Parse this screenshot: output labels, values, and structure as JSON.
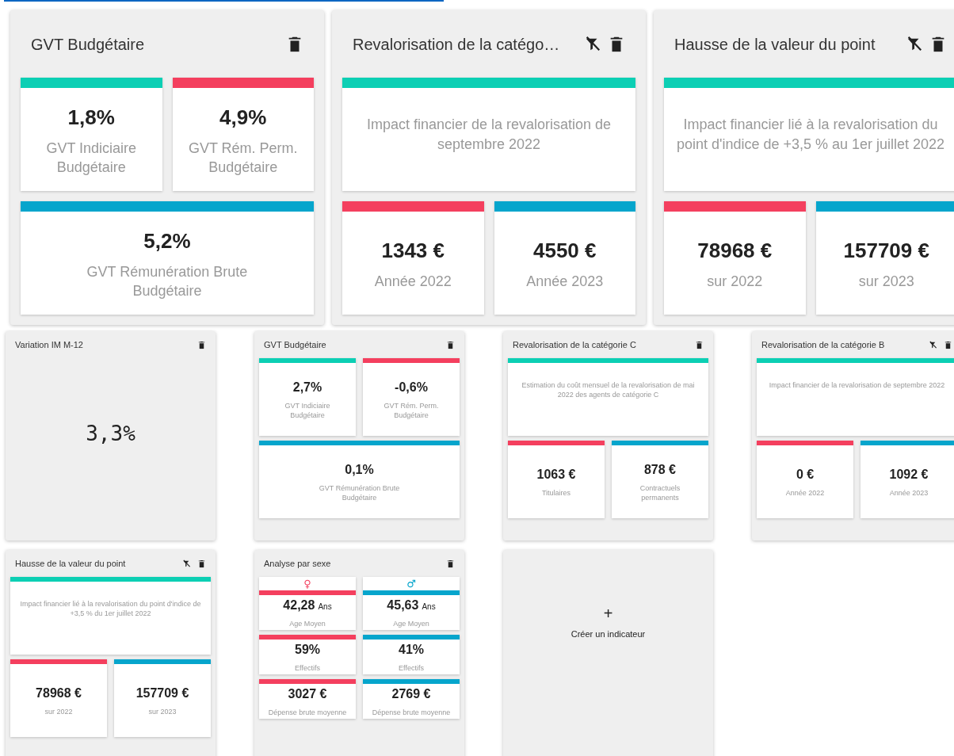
{
  "featured_widgets": [
    {
      "kind": "split",
      "title": "GVT Budgétaire",
      "filter_icon": false,
      "tiles": [
        {
          "value": "1,8%",
          "label": "GVT Indiciaire Budgétaire",
          "color": "#0ccfb4"
        },
        {
          "value": "4,9%",
          "label": "GVT Rém. Perm. Budgétaire",
          "color": "#f43f5e"
        },
        {
          "value": "5,2%",
          "label": "GVT Rémunération Brute Budgétaire",
          "color": "#06a5cc"
        }
      ]
    },
    {
      "kind": "description",
      "title": "Revalorisation de la catégo…",
      "filter_icon": true,
      "description": {
        "text": "Impact financier de la revalorisation de septembre 2022",
        "color": "#0ccfb4"
      },
      "tiles": [
        {
          "value": "1343 €",
          "label": "Année 2022",
          "color": "#f43f5e"
        },
        {
          "value": "4550 €",
          "label": "Année 2023",
          "color": "#06a5cc"
        }
      ]
    },
    {
      "kind": "description",
      "title": "Hausse de la valeur du point",
      "filter_icon": true,
      "description": {
        "text": "Impact financier lié à la revalorisation du point d'indice de +3,5 % au 1er juillet 2022",
        "color": "#0ccfb4"
      },
      "tiles": [
        {
          "value": "78968 €",
          "label": "sur 2022",
          "color": "#f43f5e"
        },
        {
          "value": "157709 €",
          "label": "sur 2023",
          "color": "#06a5cc"
        }
      ]
    }
  ],
  "widgets": [
    {
      "kind": "single",
      "title": "Variation IM M-12",
      "filter_icon": false,
      "value": "3,3%"
    },
    {
      "kind": "split",
      "title": "GVT Budgétaire",
      "filter_icon": false,
      "tiles": [
        {
          "value": "2,7%",
          "label": "GVT Indiciaire Budgétaire",
          "color": "#0ccfb4"
        },
        {
          "value": "-0,6%",
          "label": "GVT Rém. Perm. Budgétaire",
          "color": "#f43f5e"
        },
        {
          "value": "0,1%",
          "label": "GVT Rémunération Brute Budgétaire",
          "color": "#06a5cc"
        }
      ]
    },
    {
      "kind": "description",
      "title": "Revalorisation de la catégorie C",
      "filter_icon": false,
      "description": {
        "text": "Estimation du coût mensuel de la revalorisation de mai 2022 des agents de catégorie C",
        "color": "#0ccfb4"
      },
      "tiles": [
        {
          "value": "1063 €",
          "label": "Titulaires",
          "color": "#f43f5e"
        },
        {
          "value": "878 €",
          "label": "Contractuels permanents",
          "color": "#06a5cc"
        }
      ]
    },
    {
      "kind": "description",
      "title": "Revalorisation de la catégorie B",
      "filter_icon": true,
      "description": {
        "text": "Impact financier de la revalorisation de septembre 2022",
        "color": "#0ccfb4"
      },
      "tiles": [
        {
          "value": "0 €",
          "label": "Année 2022",
          "color": "#f43f5e"
        },
        {
          "value": "1092 €",
          "label": "Année 2023",
          "color": "#06a5cc"
        }
      ]
    },
    {
      "kind": "description",
      "title": "Hausse de la valeur du point",
      "filter_icon": true,
      "description": {
        "text": "Impact financier lié à la revalorisation du point d'indice de +3,5 % du 1er juillet 2022",
        "color": "#0ccfb4"
      },
      "tiles": [
        {
          "value": "78968 €",
          "label": "sur 2022",
          "color": "#f43f5e"
        },
        {
          "value": "157709 €",
          "label": "sur 2023",
          "color": "#06a5cc"
        }
      ]
    },
    {
      "kind": "gender",
      "title": "Analyse par sexe",
      "filter_icon": false,
      "groups": [
        {
          "symbol": "♀",
          "color": "#f43f5e",
          "stats": [
            {
              "value": "42,28",
              "unit": "Ans",
              "label": "Age Moyen"
            },
            {
              "value": "59%",
              "label": "Effectifs"
            },
            {
              "value": "3027 €",
              "label": "Dépense brute moyenne"
            }
          ]
        },
        {
          "symbol": "♂",
          "color": "#06a5cc",
          "stats": [
            {
              "value": "45,63",
              "unit": "Ans",
              "label": "Age Moyen"
            },
            {
              "value": "41%",
              "label": "Effectifs"
            },
            {
              "value": "2769 €",
              "label": "Dépense brute moyenne"
            }
          ]
        }
      ]
    },
    {
      "kind": "add",
      "plus": "+",
      "label": "Créer un indicateur"
    }
  ]
}
